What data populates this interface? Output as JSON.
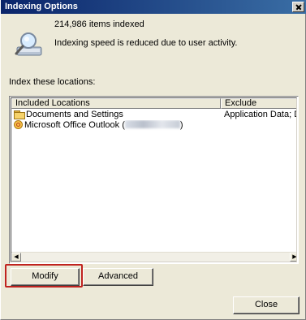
{
  "window": {
    "title": "Indexing Options"
  },
  "summary": {
    "items_indexed": "214,986 items indexed",
    "status": "Indexing speed is reduced due to user activity."
  },
  "locations": {
    "label": "Index these locations:",
    "columns": {
      "included": "Included Locations",
      "exclude": "Exclude"
    },
    "rows": [
      {
        "icon": "folder-icon",
        "included": "Documents and Settings",
        "exclude": "Application Data; Default"
      },
      {
        "icon": "outlook-icon",
        "included_prefix": "Microsoft Office Outlook (",
        "included_suffix": ")",
        "exclude": ""
      }
    ]
  },
  "buttons": {
    "modify": "Modify",
    "advanced": "Advanced",
    "close": "Close"
  },
  "colors": {
    "highlight": "#c0231f",
    "titlebar": "#0a246a"
  }
}
